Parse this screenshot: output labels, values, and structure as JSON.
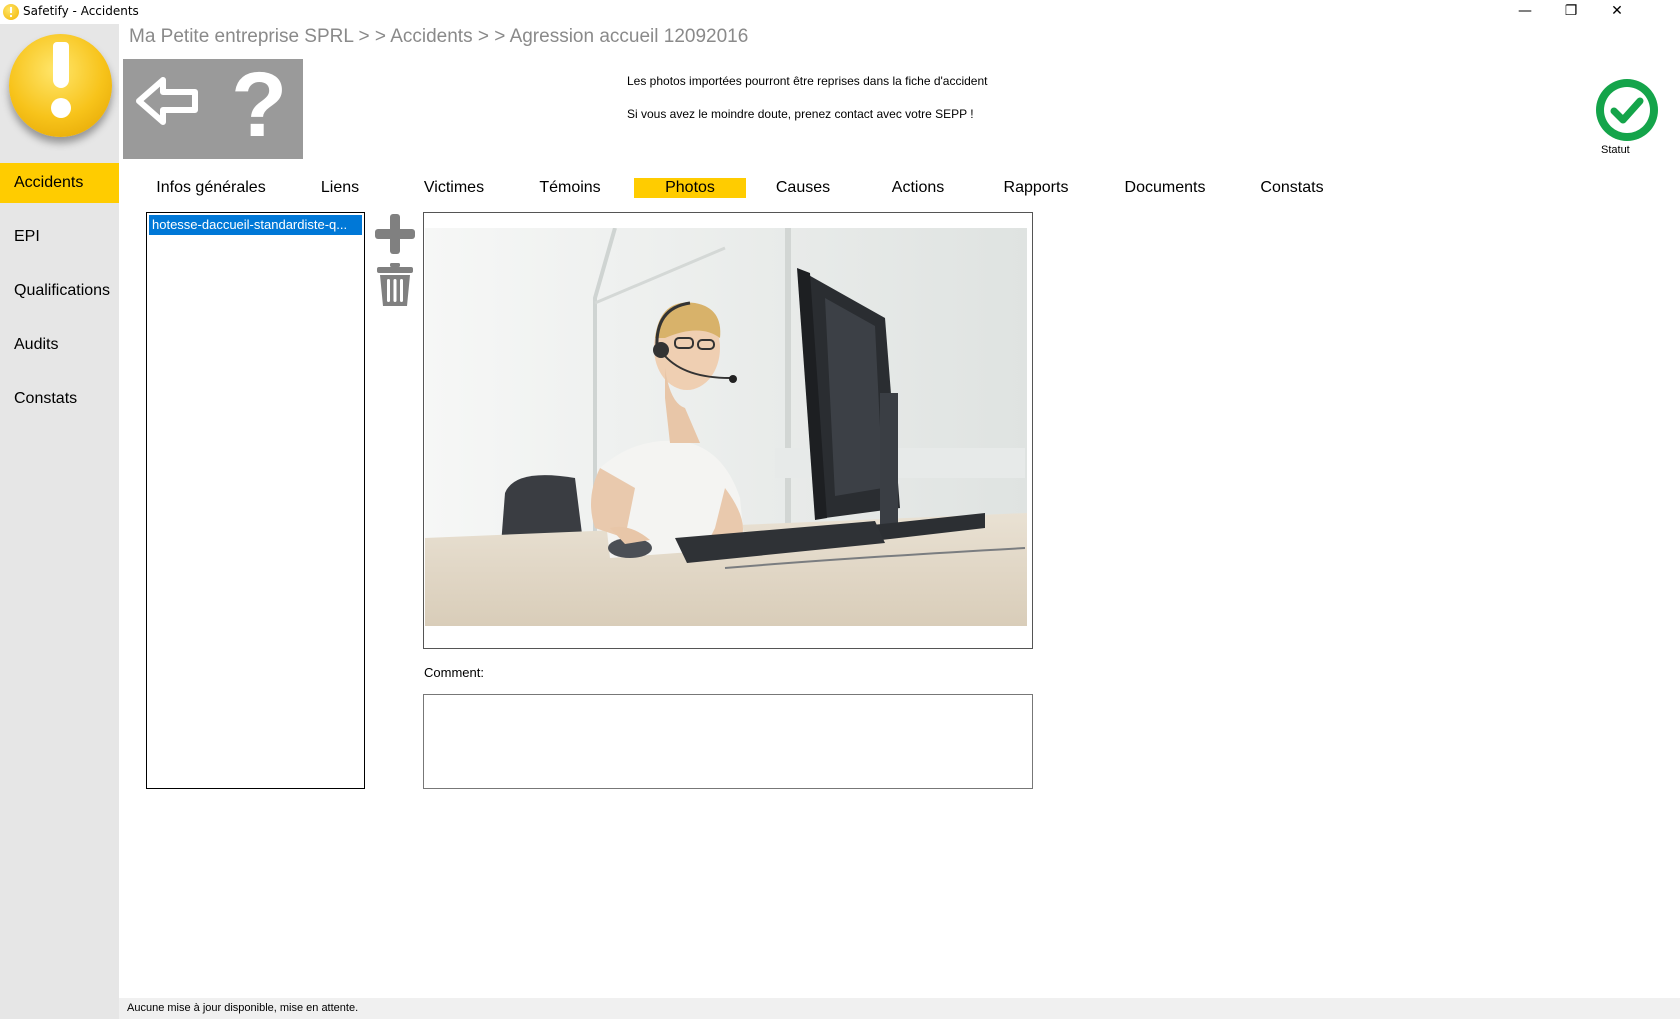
{
  "window": {
    "title": "Safetify - Accidents",
    "minimize": "—",
    "restore": "❐",
    "close": "✕"
  },
  "sidebar": {
    "items": [
      {
        "label": "Accidents",
        "active": true
      },
      {
        "label": "EPI",
        "active": false
      },
      {
        "label": "Qualifications",
        "active": false
      },
      {
        "label": "Audits",
        "active": false
      },
      {
        "label": "Constats",
        "active": false
      }
    ]
  },
  "breadcrumb": "Ma Petite entreprise SPRL > > Accidents > > Agression accueil 12092016",
  "toolbar": {
    "back_icon": "back-arrow-icon",
    "help_icon": "question-mark-icon",
    "help_glyph": "?"
  },
  "info": {
    "line1": "Les photos importées pourront être reprises dans la fiche d'accident",
    "line2": "Si vous avez le moindre doute, prenez contact avec votre SEPP !"
  },
  "statut": {
    "label": "Statut",
    "icon": "check-circle-icon",
    "color": "#14a44a"
  },
  "tabs": [
    {
      "label": "Infos générales",
      "active": false
    },
    {
      "label": "Liens",
      "active": false
    },
    {
      "label": "Victimes",
      "active": false
    },
    {
      "label": "Témoins",
      "active": false
    },
    {
      "label": "Photos",
      "active": true
    },
    {
      "label": "Causes",
      "active": false
    },
    {
      "label": "Actions",
      "active": false
    },
    {
      "label": "Rapports",
      "active": false
    },
    {
      "label": "Documents",
      "active": false
    },
    {
      "label": "Constats",
      "active": false
    }
  ],
  "photos": {
    "files": [
      "hotesse-daccueil-standardiste-q..."
    ],
    "add_icon": "plus-icon",
    "delete_icon": "trash-icon",
    "comment_label": "Comment:",
    "comment_value": ""
  },
  "status_bar": "Aucune mise à jour disponible, mise en attente.",
  "colors": {
    "accent": "#ffcc00",
    "sidebar_bg": "#e6e6e6",
    "selection": "#0078d7",
    "breadcrumb": "#8a8a8a"
  }
}
